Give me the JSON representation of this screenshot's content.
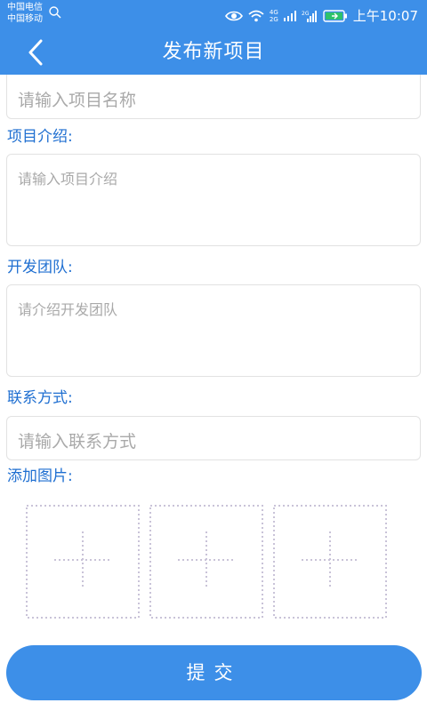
{
  "status_bar": {
    "carrier_1": "中国电信",
    "carrier_2": "中国移动",
    "network_1": "4G",
    "network_2": "2G",
    "time": "上午10:07",
    "icons": [
      "search-icon",
      "eye-icon",
      "wifi-icon",
      "signal-icon",
      "battery-icon"
    ]
  },
  "header": {
    "title": "发布新项目",
    "back_icon": "chevron-left-icon"
  },
  "form": {
    "name_placeholder": "请输入项目名称",
    "intro_label": "项目介绍:",
    "intro_placeholder": "请输入项目介绍",
    "team_label": "开发团队:",
    "team_placeholder": "请介绍开发团队",
    "contact_label": "联系方式:",
    "contact_placeholder": "请输入联系方式",
    "images_label": "添加图片:",
    "image_slots": [
      {
        "icon": "plus-icon"
      },
      {
        "icon": "plus-icon"
      },
      {
        "icon": "plus-icon"
      }
    ]
  },
  "actions": {
    "submit_label": "提交"
  },
  "colors": {
    "primary": "#3d8fe8",
    "label": "#1f6fd1",
    "placeholder": "#a9a9a9",
    "dotted": "#c9c3d8"
  }
}
